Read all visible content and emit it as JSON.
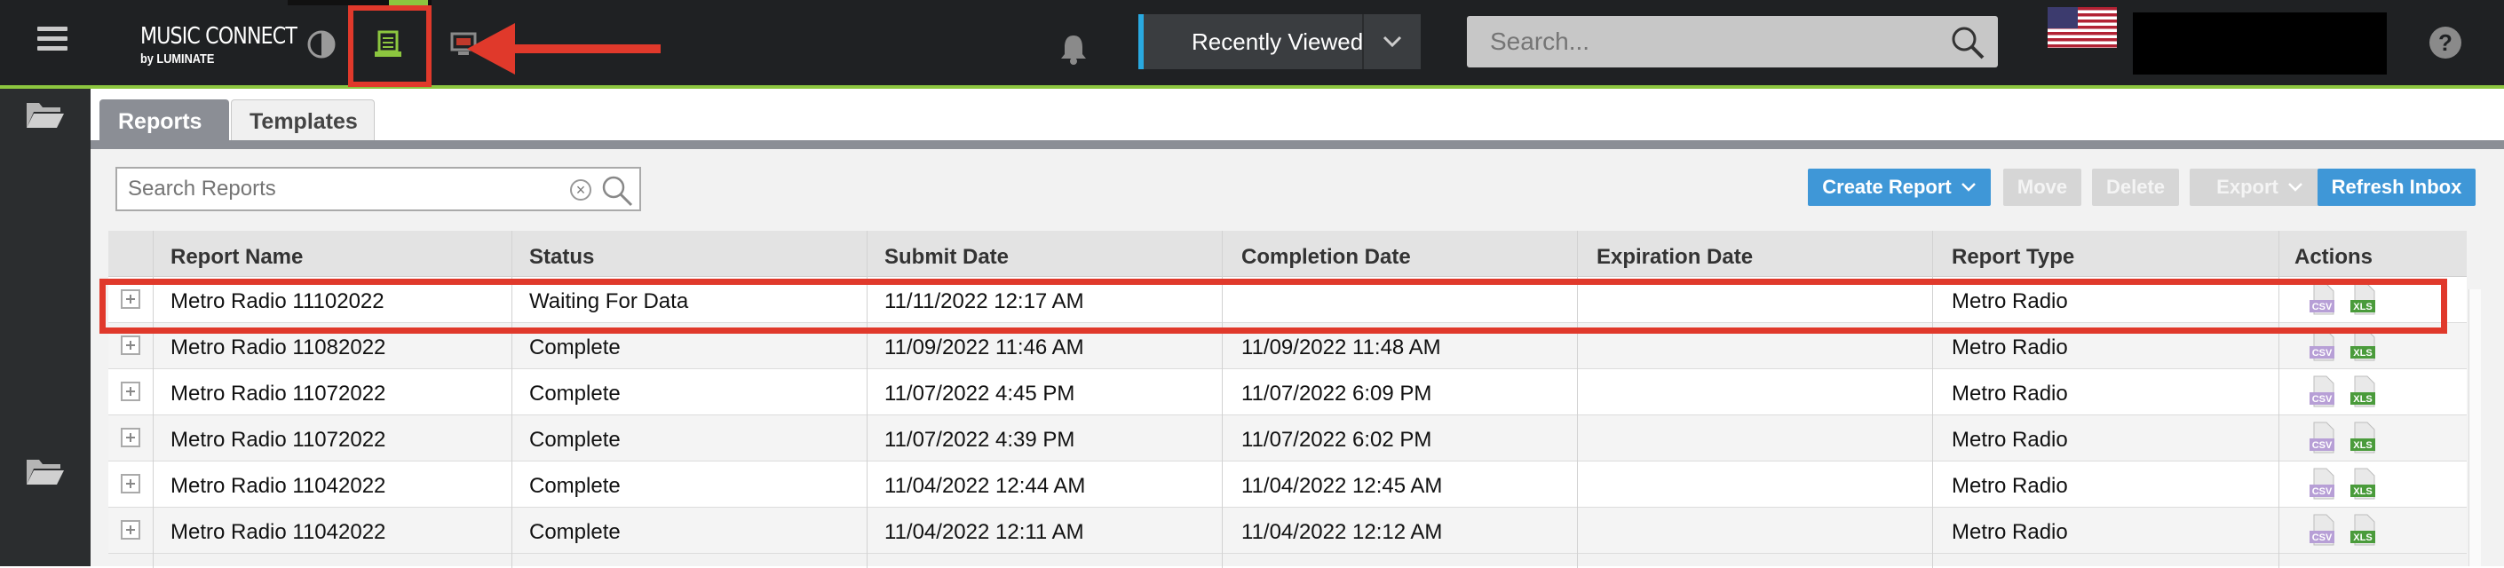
{
  "app": {
    "logo_line1": "MUSIC CONNECT",
    "logo_line2": "by LUMINATE"
  },
  "topbar": {
    "recently_viewed_label": "Recently Viewed",
    "search_placeholder": "Search...",
    "help_label": "?"
  },
  "tabs": [
    {
      "label": "Reports",
      "active": true
    },
    {
      "label": "Templates",
      "active": false
    }
  ],
  "toolbar": {
    "search_placeholder": "Search Reports",
    "create_report_label": "Create Report",
    "move_label": "Move",
    "delete_label": "Delete",
    "export_label": "Export",
    "refresh_label": "Refresh Inbox"
  },
  "table": {
    "columns": [
      "Report Name",
      "Status",
      "Submit Date",
      "Completion Date",
      "Expiration Date",
      "Report Type",
      "Actions"
    ],
    "rows": [
      {
        "name": "Metro Radio 11102022",
        "status": "Waiting For Data",
        "submit": "11/11/2022 12:17 AM",
        "completion": "",
        "expiration": "",
        "type": "Metro Radio"
      },
      {
        "name": "Metro Radio 11082022",
        "status": "Complete",
        "submit": "11/09/2022 11:46 AM",
        "completion": "11/09/2022 11:48 AM",
        "expiration": "",
        "type": "Metro Radio"
      },
      {
        "name": "Metro Radio 11072022",
        "status": "Complete",
        "submit": "11/07/2022 4:45 PM",
        "completion": "11/07/2022 6:09 PM",
        "expiration": "",
        "type": "Metro Radio"
      },
      {
        "name": "Metro Radio 11072022",
        "status": "Complete",
        "submit": "11/07/2022 4:39 PM",
        "completion": "11/07/2022 6:02 PM",
        "expiration": "",
        "type": "Metro Radio"
      },
      {
        "name": "Metro Radio 11042022",
        "status": "Complete",
        "submit": "11/04/2022 12:44 AM",
        "completion": "11/04/2022 12:45 AM",
        "expiration": "",
        "type": "Metro Radio"
      },
      {
        "name": "Metro Radio 11042022",
        "status": "Complete",
        "submit": "11/04/2022 12:11 AM",
        "completion": "11/04/2022 12:12 AM",
        "expiration": "",
        "type": "Metro Radio"
      }
    ],
    "action_labels": {
      "csv": "CSV",
      "xls": "XLS"
    }
  },
  "colors": {
    "accent_green": "#8cc63f",
    "highlight_red": "#e0392b",
    "button_blue": "#3f97d7",
    "topbar_bg": "#1f2123"
  }
}
